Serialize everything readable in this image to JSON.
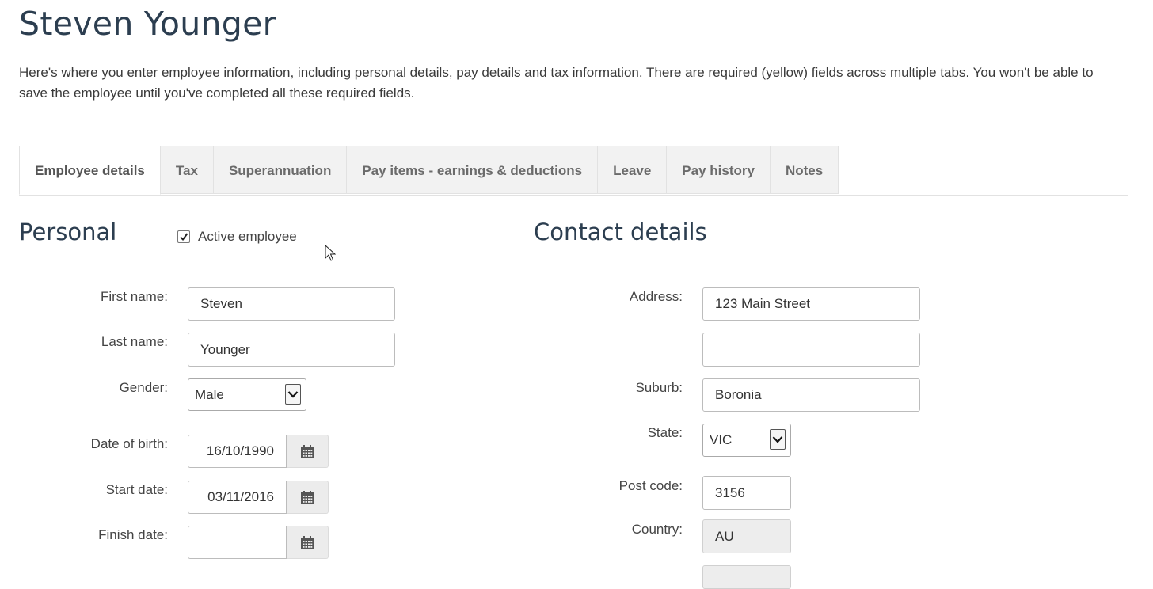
{
  "page": {
    "title": "Steven Younger",
    "intro": "Here's where you enter employee information, including personal details, pay details and tax information. There are required (yellow) fields across multiple tabs. You won't be able to save the employee until you've completed all these required fields."
  },
  "tabs": [
    {
      "label": "Employee details",
      "active": true
    },
    {
      "label": "Tax"
    },
    {
      "label": "Superannuation"
    },
    {
      "label": "Pay items - earnings & deductions"
    },
    {
      "label": "Leave"
    },
    {
      "label": "Pay history"
    },
    {
      "label": "Notes"
    }
  ],
  "personal": {
    "heading": "Personal",
    "active_employee_label": "Active employee",
    "active_employee_checked": true,
    "first_name": {
      "label": "First name:",
      "value": "Steven"
    },
    "last_name": {
      "label": "Last name:",
      "value": "Younger"
    },
    "gender": {
      "label": "Gender:",
      "value": "Male"
    },
    "date_of_birth": {
      "label": "Date of birth:",
      "value": "16/10/1990"
    },
    "start_date": {
      "label": "Start date:",
      "value": "03/11/2016"
    },
    "finish_date": {
      "label": "Finish date:",
      "value": ""
    }
  },
  "contact": {
    "heading": "Contact details",
    "address": {
      "label": "Address:",
      "line1": "123 Main Street",
      "line2": ""
    },
    "suburb": {
      "label": "Suburb:",
      "value": "Boronia"
    },
    "state": {
      "label": "State:",
      "value": "VIC"
    },
    "post_code": {
      "label": "Post code:",
      "value": "3156"
    },
    "country": {
      "label": "Country:",
      "value": "AU"
    }
  },
  "icons": {
    "calendar": "calendar-icon",
    "dropdown": "chevron-down-icon",
    "checkmark": "checkmark-icon",
    "cursor": "mouse-pointer-icon"
  }
}
